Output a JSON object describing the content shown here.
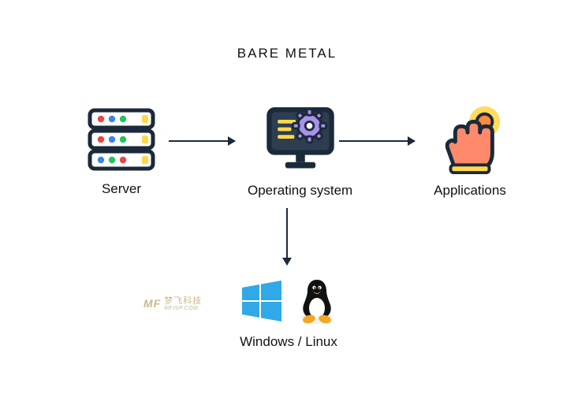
{
  "title": "BARE METAL",
  "nodes": {
    "server": {
      "label": "Server"
    },
    "os": {
      "label": "Operating system"
    },
    "apps": {
      "label": "Applications"
    },
    "osoptions": {
      "label": "Windows / Linux"
    }
  },
  "watermark": {
    "logo": "MF",
    "text": "梦飞科技",
    "sub": "MFISP.COM"
  }
}
